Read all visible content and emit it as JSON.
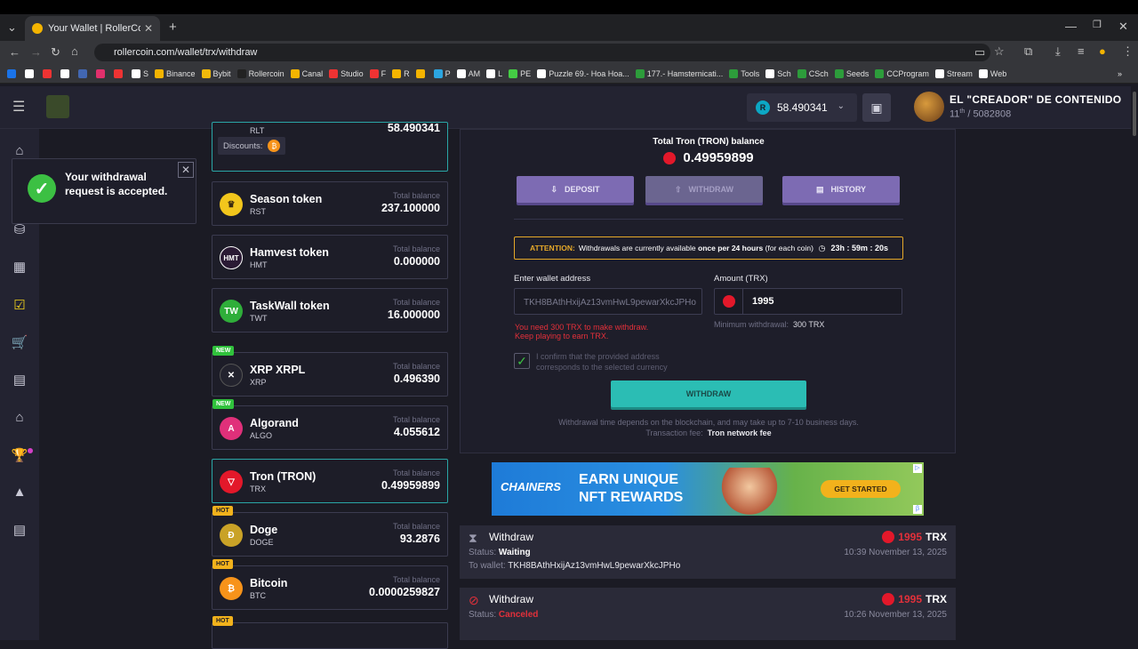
{
  "browser": {
    "tab_title": "Your Wallet | RollerCoin.com | W",
    "url": "rollercoin.com/wallet/trx/withdraw",
    "bookmarks": [
      "",
      "",
      "",
      "",
      "",
      "",
      "",
      "S",
      "Binance",
      "Bybit",
      "Rollercoin",
      "Canal",
      "Studio",
      "F",
      "R",
      "",
      "P",
      "AM",
      "L",
      "PE",
      "Puzzle 69.- Hoa Hoa...",
      "177.- Hamsternicati...",
      "Tools",
      "Sch",
      "CSch",
      "Seeds",
      "CCProgram",
      "Stream",
      "Web"
    ]
  },
  "header": {
    "balance": "58.490341",
    "balance_coin_icon": "R",
    "username": "EL \"CREADOR\" DE CONTENIDO",
    "rank": "11",
    "rank_suffix": "th",
    "rank_total": "/ 5082808"
  },
  "toast": {
    "message": "Your withdrawal request is accepted.",
    "close_glyph": "✕",
    "icon_glyph": "✓"
  },
  "coins_top": {
    "symbol": "RLT",
    "balance": "58.490341",
    "discounts_label": "Discounts:"
  },
  "coins": [
    {
      "name": "Season token",
      "symbol": "RST",
      "label": "Total balance",
      "balance": "237.100000",
      "badge": "",
      "icon": "crown",
      "color": "#f2c61c",
      "glyph": "♛"
    },
    {
      "name": "Hamvest token",
      "symbol": "HMT",
      "label": "Total balance",
      "balance": "0.000000",
      "badge": "",
      "icon": "hmt",
      "color": "#2a1a34",
      "glyph": "HMT"
    },
    {
      "name": "TaskWall token",
      "symbol": "TWT",
      "label": "Total balance",
      "balance": "16.000000",
      "badge": "",
      "icon": "tw",
      "color": "#2fae3a",
      "glyph": "TW"
    },
    {
      "name": "XRP XRPL",
      "symbol": "XRP",
      "label": "Total balance",
      "balance": "0.496390",
      "badge": "NEW",
      "icon": "xrp",
      "color": "#23232e",
      "glyph": "✕"
    },
    {
      "name": "Algorand",
      "symbol": "ALGO",
      "label": "Total balance",
      "balance": "4.055612",
      "badge": "NEW",
      "icon": "algo",
      "color": "#e0307a",
      "glyph": "A"
    },
    {
      "name": "Tron (TRON)",
      "symbol": "TRX",
      "label": "Total balance",
      "balance": "0.49959899",
      "badge": "",
      "icon": "tron",
      "color": "#e3182a",
      "glyph": "▽"
    },
    {
      "name": "Doge",
      "symbol": "DOGE",
      "label": "Total balance",
      "balance": "93.2876",
      "badge": "HOT",
      "icon": "doge",
      "color": "#c9a227",
      "glyph": "Ð"
    },
    {
      "name": "Bitcoin",
      "symbol": "BTC",
      "label": "Total balance",
      "balance": "0.0000259827",
      "badge": "HOT",
      "icon": "btc",
      "color": "#f7931a",
      "glyph": "₿"
    }
  ],
  "coin_last_badge": "HOT",
  "withdraw": {
    "total_label": "Total Tron (TRON) balance",
    "total_value": "0.49959899",
    "buttons": {
      "deposit": "DEPOSIT",
      "withdraw": "WITHDRAW",
      "history": "HISTORY"
    },
    "attention_label": "ATTENTION:",
    "attention_text": "Withdrawals are currently available",
    "attention_bold": "once per 24 hours",
    "attention_tail": "(for each coin)",
    "timer": "23h : 59m : 20s",
    "wallet_label": "Enter wallet address",
    "wallet_value": "TKH8BAthHxijAz13vmHwL9pewarXkcJPHo",
    "amount_label": "Amount (TRX)",
    "amount_value": "1995",
    "min_label": "Minimum withdrawal:",
    "min_value": "300 TRX",
    "error_line1": "You need 300 TRX to make withdraw.",
    "error_line2": "Keep playing to earn TRX.",
    "confirm_text_1": "I confirm that the provided address",
    "confirm_text_2": "corresponds to the selected currency",
    "checked": true,
    "submit": "WITHDRAW",
    "note": "Withdrawal time depends on the blockchain, and may take up to 7-10 business days.",
    "fee_label": "Transaction fee:",
    "fee_value": "Tron network fee"
  },
  "ad": {
    "logo": "CHAINERS",
    "title_1": "EARN UNIQUE",
    "title_2": "NFT REWARDS",
    "cta": "GET STARTED"
  },
  "history": [
    {
      "title": "Withdraw",
      "amount": "1995",
      "unit": "TRX",
      "status_label": "Status:",
      "status": "Waiting",
      "status_color": "#ffffff",
      "wallet_label": "To wallet:",
      "wallet": "TKH8BAthHxijAz13vmHwL9pewarXkcJPHo",
      "time": "10:39 November 13, 2025",
      "icon": "hourglass-icon"
    },
    {
      "title": "Withdraw",
      "amount": "1995",
      "unit": "TRX",
      "status_label": "Status:",
      "status": "Canceled",
      "status_color": "#e3303a",
      "wallet_label": "",
      "wallet": "",
      "time": "10:26 November 13, 2025",
      "icon": "cancel-icon"
    }
  ],
  "colors": {
    "accent": "#2bbdb4",
    "purple": "#7d6bb3",
    "error": "#e3303a",
    "attention": "#e5a829",
    "tron": "#e3182a"
  }
}
